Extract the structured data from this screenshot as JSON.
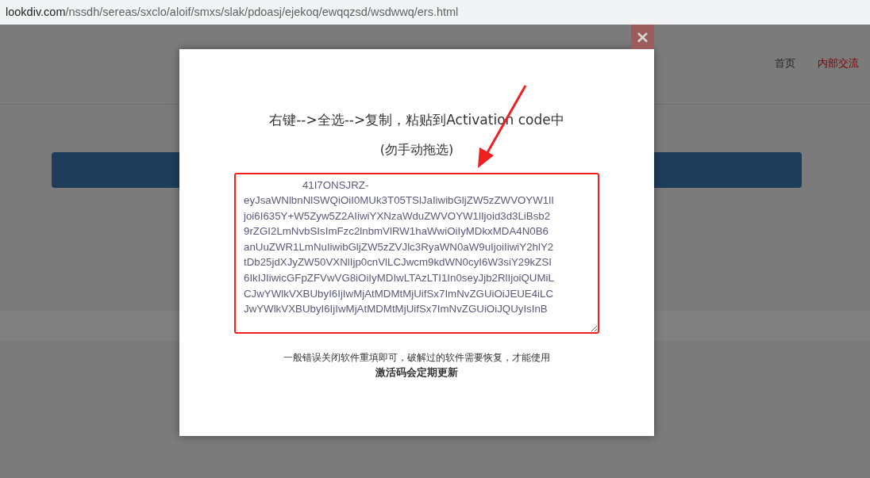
{
  "address_bar": {
    "url": "lookdiv.com/nssdh/sereas/sxclo/aloif/smxs/slak/pdoasj/ejekoq/ewqqzsd/wsdwwq/ers.html"
  },
  "nav": [
    {
      "label": "首页",
      "selected": false
    },
    {
      "label": "内部交流",
      "selected": true
    }
  ],
  "modal": {
    "close": "×",
    "instruction": "右键-->全选-->复制，粘贴到Activation code中",
    "hint": "(勿手动拖选)",
    "code": "                    41I7ONSJRZ-\neyJsaWNlbnNlSWQiOiI0MUk3T05TSlJaIiwibGljZW5zZWVOYW1lI\njoi6I635Y+W5Zyw5Z2AIiwiYXNzaWduZWVOYW1lIjoid3d3LiBsb2\n9rZGI2LmNvbSIsImFzc2lnbmVlRW1haWwiOiIyMDkxMDA4N0B6\nanUuZWR1LmNuIiwibGljZW5zZVJlc3RyaWN0aW9uIjoiIiwiY2hlY2\ntDb25jdXJyZW50VXNlIjp0cnVlLCJwcm9kdWN0cyI6W3siY29kZSI\n6IkIJIiwicGFpZFVwVG8iOiIyMDIwLTAzLTI1In0seyJjb2RlIjoiQUMiL\nCJwYWlkVXBUbyI6IjIwMjAtMDMtMjUifSx7ImNvZGUiOiJEUE4iLC\nJwYWlkVXBUbyI6IjIwMjAtMDMtMjUifSx7ImNvZGUiOiJQUyIsInB",
    "note": "一般错误关闭软件重填即可，破解过的软件需要恢复，才能使用",
    "note_bold": "激活码会定期更新"
  }
}
